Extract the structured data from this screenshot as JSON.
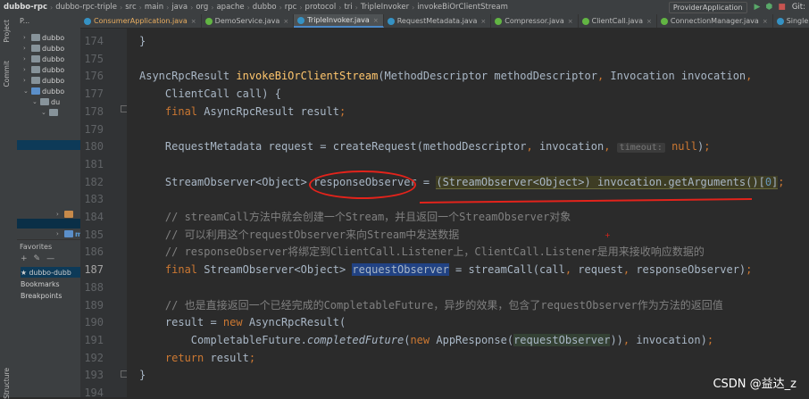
{
  "breadcrumb": [
    "dubbo-rpc",
    "dubbo-rpc-triple",
    "src",
    "main",
    "java",
    "org",
    "apache",
    "dubbo",
    "rpc",
    "protocol",
    "tri",
    "TripleInvoker",
    "invokeBiOrClientStream"
  ],
  "toolbar": {
    "run_config": "ProviderApplication",
    "git_label": "Git:",
    "run_icon": "▶",
    "debug_icon": "⬢",
    "stop_icon": "■"
  },
  "left_strip": {
    "project": "Project",
    "commit": "Commit",
    "structure": "Structure"
  },
  "project_panel": {
    "header": "P...",
    "tree": [
      {
        "label": "dubbo",
        "icon": "folder"
      },
      {
        "label": "dubbo",
        "icon": "folder"
      },
      {
        "label": "dubbo",
        "icon": "folder"
      },
      {
        "label": "dubbo",
        "icon": "folder"
      },
      {
        "label": "dubbo",
        "icon": "folder"
      },
      {
        "label": "dubbo",
        "icon": "folder-blue"
      },
      {
        "label": "du",
        "icon": "folder"
      },
      {
        "label": "",
        "icon": "folder"
      }
    ],
    "lower_items": [
      {
        "label": "",
        "icon": "folder-orange"
      },
      {
        "label": "m",
        "icon": "folder-blue"
      }
    ]
  },
  "favorites": {
    "header": "Favorites",
    "tools": [
      "+",
      "✎",
      "—"
    ],
    "items": [
      {
        "label": "★ dubbo-dubb",
        "selected": true
      },
      {
        "label": "Bookmarks",
        "selected": false
      },
      {
        "label": "Breakpoints",
        "selected": false
      }
    ]
  },
  "tabs": [
    {
      "label": "ConsumerApplication.java",
      "icon": "class",
      "active": false,
      "modified": true
    },
    {
      "label": "DemoService.java",
      "icon": "interface",
      "active": false,
      "modified": false
    },
    {
      "label": "TripleInvoker.java",
      "icon": "class",
      "active": true,
      "modified": false
    },
    {
      "label": "RequestMetadata.java",
      "icon": "class",
      "active": false,
      "modified": false
    },
    {
      "label": "Compressor.java",
      "icon": "interface",
      "active": false,
      "modified": false
    },
    {
      "label": "ClientCall.java",
      "icon": "interface",
      "active": false,
      "modified": false
    },
    {
      "label": "ConnectionManager.java",
      "icon": "interface",
      "active": false,
      "modified": false
    },
    {
      "label": "SingleProtocolConnect",
      "icon": "class",
      "active": false,
      "modified": false
    }
  ],
  "editor": {
    "current_line": 187,
    "lines": [
      {
        "n": "174",
        "segs": [
          {
            "t": "}"
          }
        ]
      },
      {
        "n": "175",
        "segs": []
      },
      {
        "n": "176",
        "segs": [
          {
            "t": "AsyncRpcResult "
          },
          {
            "t": "invokeBiOrClientStream",
            "c": "fn"
          },
          {
            "t": "(MethodDescriptor methodDescriptor"
          },
          {
            "t": ",",
            "c": "kw"
          },
          {
            "t": " Invocation invocation"
          },
          {
            "t": ",",
            "c": "kw"
          }
        ]
      },
      {
        "n": "177",
        "segs": [
          {
            "t": "    ClientCall call) {"
          }
        ]
      },
      {
        "n": "178",
        "segs": [
          {
            "t": "    "
          },
          {
            "t": "final",
            "c": "kw"
          },
          {
            "t": " AsyncRpcResult result"
          },
          {
            "t": ";",
            "c": "kw"
          }
        ]
      },
      {
        "n": "179",
        "segs": []
      },
      {
        "n": "180",
        "segs": [
          {
            "t": "    RequestMetadata request = createRequest(methodDescriptor"
          },
          {
            "t": ",",
            "c": "kw"
          },
          {
            "t": " invocation"
          },
          {
            "t": ",",
            "c": "kw"
          },
          {
            "t": " "
          },
          {
            "t": "timeout:",
            "c": "hint"
          },
          {
            "t": " "
          },
          {
            "t": "null",
            "c": "kw"
          },
          {
            "t": ")"
          },
          {
            "t": ";",
            "c": "kw"
          }
        ]
      },
      {
        "n": "181",
        "segs": []
      },
      {
        "n": "182",
        "segs": [
          {
            "t": "    StreamObserver<Object> responseObserver = "
          },
          {
            "t": "(StreamObserver<Object>) invocation.getArguments()[",
            "c": "hlcast"
          },
          {
            "t": "0",
            "c": "num hlcast"
          },
          {
            "t": "]",
            "c": "hlcast"
          },
          {
            "t": ";",
            "c": "kw"
          }
        ]
      },
      {
        "n": "183",
        "segs": []
      },
      {
        "n": "184",
        "segs": [
          {
            "t": "    // streamCall方法中就会创建一个Stream，并且返回一个StreamObserver对象",
            "c": "cm"
          }
        ]
      },
      {
        "n": "185",
        "segs": [
          {
            "t": "    // 可以利用这个requestObserver来向Stream中发送数据",
            "c": "cm"
          }
        ]
      },
      {
        "n": "186",
        "segs": [
          {
            "t": "    // responseObserver将绑定到ClientCall.Listener上，ClientCall.Listener是用来接收响应数据的",
            "c": "cm"
          }
        ]
      },
      {
        "n": "187",
        "segs": [
          {
            "t": "    "
          },
          {
            "t": "final",
            "c": "kw"
          },
          {
            "t": " StreamObserver<Object> "
          },
          {
            "t": "requestObserver",
            "c": "hlv"
          },
          {
            "t": " = streamCall(call"
          },
          {
            "t": ",",
            "c": "kw"
          },
          {
            "t": " request"
          },
          {
            "t": ",",
            "c": "kw"
          },
          {
            "t": " responseObserver)"
          },
          {
            "t": ";",
            "c": "kw"
          }
        ]
      },
      {
        "n": "188",
        "segs": []
      },
      {
        "n": "189",
        "segs": [
          {
            "t": "    // 也是直接返回一个已经完成的CompletableFuture，异步的效果，包含了requestObserver作为方法的返回值",
            "c": "cm"
          }
        ]
      },
      {
        "n": "190",
        "segs": [
          {
            "t": "    result = "
          },
          {
            "t": "new",
            "c": "kw"
          },
          {
            "t": " AsyncRpcResult("
          }
        ]
      },
      {
        "n": "191",
        "segs": [
          {
            "t": "        CompletableFuture."
          },
          {
            "t": "completedFuture",
            "c": "it"
          },
          {
            "t": "("
          },
          {
            "t": "new",
            "c": "kw"
          },
          {
            "t": " AppResponse("
          },
          {
            "t": "requestObserver",
            "c": "hlarg"
          },
          {
            "t": "))"
          },
          {
            "t": ",",
            "c": "kw"
          },
          {
            "t": " invocation)"
          },
          {
            "t": ";",
            "c": "kw"
          }
        ]
      },
      {
        "n": "192",
        "segs": [
          {
            "t": "    "
          },
          {
            "t": "return",
            "c": "kw"
          },
          {
            "t": " result"
          },
          {
            "t": ";",
            "c": "kw"
          }
        ]
      },
      {
        "n": "193",
        "segs": [
          {
            "t": "}"
          }
        ]
      },
      {
        "n": "194",
        "segs": []
      }
    ]
  },
  "watermark": "CSDN @益达_z"
}
